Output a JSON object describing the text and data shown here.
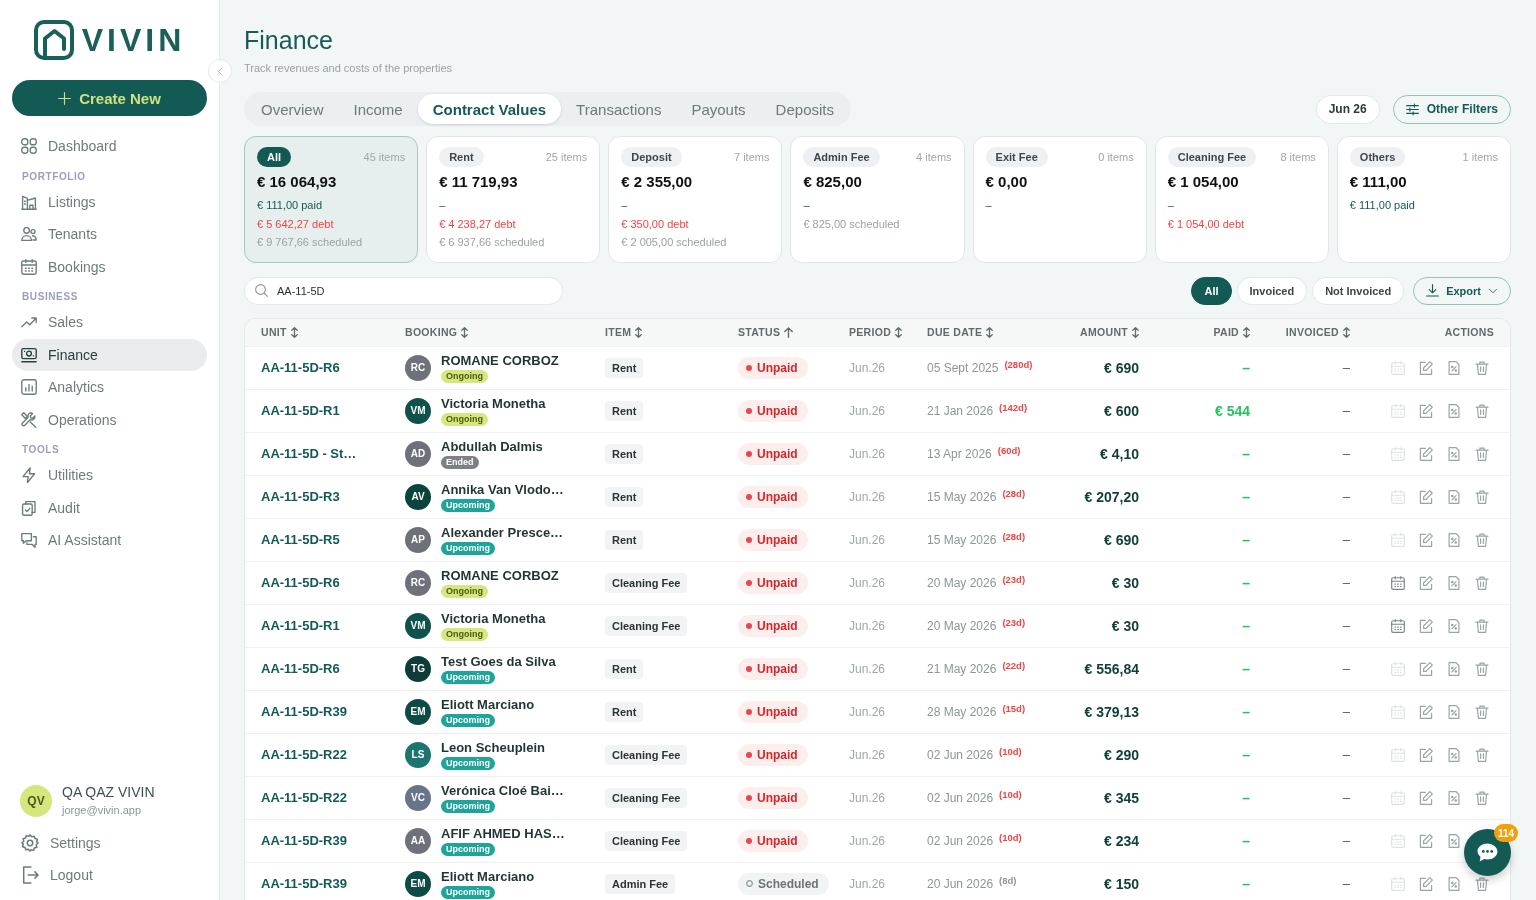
{
  "sidebar": {
    "logo": "VIVIN",
    "create_button": "Create New",
    "nav": [
      {
        "kind": "item",
        "label": "Dashboard",
        "selected": false
      },
      {
        "kind": "section",
        "label": "PORTFOLIO"
      },
      {
        "kind": "item",
        "label": "Listings",
        "selected": false
      },
      {
        "kind": "item",
        "label": "Tenants",
        "selected": false
      },
      {
        "kind": "item",
        "label": "Bookings",
        "selected": false
      },
      {
        "kind": "section",
        "label": "BUSINESS"
      },
      {
        "kind": "item",
        "label": "Sales",
        "selected": false
      },
      {
        "kind": "item",
        "label": "Finance",
        "selected": true
      },
      {
        "kind": "item",
        "label": "Analytics",
        "selected": false
      },
      {
        "kind": "item",
        "label": "Operations",
        "selected": false
      },
      {
        "kind": "section",
        "label": "TOOLS"
      },
      {
        "kind": "item",
        "label": "Utilities",
        "selected": false
      },
      {
        "kind": "item",
        "label": "Audit",
        "selected": false
      },
      {
        "kind": "item",
        "label": "AI Assistant",
        "selected": false
      }
    ],
    "user": {
      "initials": "QV",
      "name": "QA QAZ VIVIN",
      "email": "jorge@vivin.app"
    },
    "footer_items": [
      "Settings",
      "Logout"
    ]
  },
  "header": {
    "title": "Finance",
    "subtitle": "Track revenues and costs of the properties"
  },
  "tabs": [
    {
      "label": "Overview",
      "selected": false
    },
    {
      "label": "Income",
      "selected": false
    },
    {
      "label": "Contract Values",
      "selected": true
    },
    {
      "label": "Transactions",
      "selected": false
    },
    {
      "label": "Payouts",
      "selected": false
    },
    {
      "label": "Deposits",
      "selected": false
    }
  ],
  "date_button": "Jun 26",
  "filters_button": "Other Filters",
  "cards": [
    {
      "label": "All",
      "count": "45 items",
      "amount": "€ 16 064,93",
      "selected": true,
      "lines": [
        {
          "kind": "paid",
          "text": "€ 111,00 paid"
        },
        {
          "kind": "debt",
          "text": "€ 5 642,27 debt"
        },
        {
          "kind": "scheduled",
          "text": "€ 9 767,66 scheduled"
        }
      ]
    },
    {
      "label": "Rent",
      "count": "25 items",
      "amount": "€ 11 719,93",
      "selected": false,
      "lines": [
        {
          "kind": "none",
          "text": "–"
        },
        {
          "kind": "debt",
          "text": "€ 4 238,27 debt"
        },
        {
          "kind": "scheduled",
          "text": "€ 6 937,66 scheduled"
        }
      ]
    },
    {
      "label": "Deposit",
      "count": "7 items",
      "amount": "€ 2 355,00",
      "selected": false,
      "lines": [
        {
          "kind": "none",
          "text": "–"
        },
        {
          "kind": "debt",
          "text": "€ 350,00 debt"
        },
        {
          "kind": "scheduled",
          "text": "€ 2 005,00 scheduled"
        }
      ]
    },
    {
      "label": "Admin Fee",
      "count": "4 items",
      "amount": "€ 825,00",
      "selected": false,
      "lines": [
        {
          "kind": "none",
          "text": "–"
        },
        {
          "kind": "scheduled",
          "text": "€ 825,00 scheduled"
        }
      ]
    },
    {
      "label": "Exit Fee",
      "count": "0 items",
      "amount": "€ 0,00",
      "selected": false,
      "lines": [
        {
          "kind": "none",
          "text": "–"
        }
      ]
    },
    {
      "label": "Cleaning Fee",
      "count": "8 items",
      "amount": "€ 1 054,00",
      "selected": false,
      "lines": [
        {
          "kind": "none",
          "text": "–"
        },
        {
          "kind": "debt",
          "text": "€ 1 054,00 debt"
        }
      ]
    },
    {
      "label": "Others",
      "count": "1 items",
      "amount": "€ 111,00",
      "selected": false,
      "lines": [
        {
          "kind": "paid",
          "text": "€ 111,00 paid"
        }
      ]
    }
  ],
  "search": {
    "value": "AA-11-5D"
  },
  "invoice_filters": [
    {
      "label": "All",
      "selected": true
    },
    {
      "label": "Invoiced",
      "selected": false
    },
    {
      "label": "Not Invoiced",
      "selected": false
    }
  ],
  "export_button": "Export",
  "table": {
    "columns": [
      {
        "label": "UNIT",
        "sortable": true,
        "sorted": false
      },
      {
        "label": "BOOKING",
        "sortable": true,
        "sorted": false
      },
      {
        "label": "ITEM",
        "sortable": true,
        "sorted": false
      },
      {
        "label": "STATUS",
        "sortable": true,
        "sorted": true
      },
      {
        "label": "PERIOD",
        "sortable": true,
        "sorted": false
      },
      {
        "label": "DUE DATE",
        "sortable": true,
        "sorted": false
      },
      {
        "label": "AMOUNT",
        "sortable": true,
        "sorted": false
      },
      {
        "label": "PAID",
        "sortable": true,
        "sorted": false
      },
      {
        "label": "INVOICED",
        "sortable": true,
        "sorted": false
      },
      {
        "label": "ACTIONS",
        "sortable": false
      }
    ],
    "rows": [
      {
        "unit": "AA-11-5D-R6",
        "avatar": {
          "initials": "RC",
          "color": "#6e7179"
        },
        "name": "ROMANE CORBOZ",
        "booking_status": {
          "kind": "ongoing",
          "label": "Ongoing"
        },
        "item": "Rent",
        "status": {
          "kind": "unpaid",
          "label": "Unpaid"
        },
        "period": "Jun.26",
        "due_date": "05 Sept 2025",
        "due_tag": {
          "kind": "overdue",
          "label": "(280d)"
        },
        "amount": "€ 690",
        "paid": "–",
        "invoiced": "–",
        "actions": [
          {
            "kind": "calendar",
            "enabled": false
          },
          {
            "kind": "edit"
          },
          {
            "kind": "invoice"
          },
          {
            "kind": "delete"
          }
        ]
      },
      {
        "unit": "AA-11-5D-R1",
        "avatar": {
          "initials": "VM",
          "color": "#0f524c"
        },
        "name": "Victoria Monetha",
        "booking_status": {
          "kind": "ongoing",
          "label": "Ongoing"
        },
        "item": "Rent",
        "status": {
          "kind": "unpaid",
          "label": "Unpaid"
        },
        "period": "Jun.26",
        "due_date": "21 Jan 2026",
        "due_tag": {
          "kind": "overdue",
          "label": "(142d)"
        },
        "amount": "€ 600",
        "paid": "€ 544",
        "invoiced": "–",
        "actions": [
          {
            "kind": "calendar",
            "enabled": false
          },
          {
            "kind": "edit"
          },
          {
            "kind": "invoice"
          },
          {
            "kind": "delete"
          }
        ]
      },
      {
        "unit": "AA-11-5D - St…",
        "avatar": {
          "initials": "AD",
          "color": "#6e7179"
        },
        "name": "Abdullah Dalmis",
        "booking_status": {
          "kind": "ended",
          "label": "Ended"
        },
        "item": "Rent",
        "status": {
          "kind": "unpaid",
          "label": "Unpaid"
        },
        "period": "Jun.26",
        "due_date": "13 Apr 2026",
        "due_tag": {
          "kind": "overdue",
          "label": "(60d)"
        },
        "amount": "€ 4,10",
        "paid": "–",
        "invoiced": "–",
        "actions": [
          {
            "kind": "calendar",
            "enabled": false
          },
          {
            "kind": "edit"
          },
          {
            "kind": "invoice"
          },
          {
            "kind": "delete"
          }
        ]
      },
      {
        "unit": "AA-11-5D-R3",
        "avatar": {
          "initials": "AV",
          "color": "#0b433d"
        },
        "name": "Annika Van Vlodo…",
        "booking_status": {
          "kind": "upcoming",
          "label": "Upcoming"
        },
        "item": "Rent",
        "status": {
          "kind": "unpaid",
          "label": "Unpaid"
        },
        "period": "Jun.26",
        "due_date": "15 May 2026",
        "due_tag": {
          "kind": "overdue",
          "label": "(28d)"
        },
        "amount": "€ 207,20",
        "paid": "–",
        "invoiced": "–",
        "actions": [
          {
            "kind": "calendar",
            "enabled": false
          },
          {
            "kind": "edit"
          },
          {
            "kind": "invoice"
          },
          {
            "kind": "delete"
          }
        ]
      },
      {
        "unit": "AA-11-5D-R5",
        "avatar": {
          "initials": "AP",
          "color": "#6e7179"
        },
        "name": "Alexander Presce…",
        "booking_status": {
          "kind": "upcoming",
          "label": "Upcoming"
        },
        "item": "Rent",
        "status": {
          "kind": "unpaid",
          "label": "Unpaid"
        },
        "period": "Jun.26",
        "due_date": "15 May 2026",
        "due_tag": {
          "kind": "overdue",
          "label": "(28d)"
        },
        "amount": "€ 690",
        "paid": "–",
        "invoiced": "–",
        "actions": [
          {
            "kind": "calendar",
            "enabled": false
          },
          {
            "kind": "edit"
          },
          {
            "kind": "invoice"
          },
          {
            "kind": "delete"
          }
        ]
      },
      {
        "unit": "AA-11-5D-R6",
        "avatar": {
          "initials": "RC",
          "color": "#6e7179"
        },
        "name": "ROMANE CORBOZ",
        "booking_status": {
          "kind": "ongoing",
          "label": "Ongoing"
        },
        "item": "Cleaning Fee",
        "status": {
          "kind": "unpaid",
          "label": "Unpaid"
        },
        "period": "Jun.26",
        "due_date": "20 May 2026",
        "due_tag": {
          "kind": "overdue",
          "label": "(23d)"
        },
        "amount": "€ 30",
        "paid": "–",
        "invoiced": "–",
        "actions": [
          {
            "kind": "calendar",
            "enabled": true
          },
          {
            "kind": "edit"
          },
          {
            "kind": "invoice"
          },
          {
            "kind": "delete"
          }
        ]
      },
      {
        "unit": "AA-11-5D-R1",
        "avatar": {
          "initials": "VM",
          "color": "#0f524c"
        },
        "name": "Victoria Monetha",
        "booking_status": {
          "kind": "ongoing",
          "label": "Ongoing"
        },
        "item": "Cleaning Fee",
        "status": {
          "kind": "unpaid",
          "label": "Unpaid"
        },
        "period": "Jun.26",
        "due_date": "20 May 2026",
        "due_tag": {
          "kind": "overdue",
          "label": "(23d)"
        },
        "amount": "€ 30",
        "paid": "–",
        "invoiced": "–",
        "actions": [
          {
            "kind": "calendar",
            "enabled": true
          },
          {
            "kind": "edit"
          },
          {
            "kind": "invoice"
          },
          {
            "kind": "delete"
          }
        ]
      },
      {
        "unit": "AA-11-5D-R6",
        "avatar": {
          "initials": "TG",
          "color": "#0e3d39"
        },
        "name": "Test Goes da Silva",
        "booking_status": {
          "kind": "upcoming",
          "label": "Upcoming"
        },
        "item": "Rent",
        "status": {
          "kind": "unpaid",
          "label": "Unpaid"
        },
        "period": "Jun.26",
        "due_date": "21 May 2026",
        "due_tag": {
          "kind": "overdue",
          "label": "(22d)"
        },
        "amount": "€ 556,84",
        "paid": "–",
        "invoiced": "–",
        "actions": [
          {
            "kind": "calendar",
            "enabled": false
          },
          {
            "kind": "edit"
          },
          {
            "kind": "invoice"
          },
          {
            "kind": "delete"
          }
        ]
      },
      {
        "unit": "AA-11-5D-R39",
        "avatar": {
          "initials": "EM",
          "color": "#0f4b45"
        },
        "name": "Eliott Marciano",
        "booking_status": {
          "kind": "upcoming",
          "label": "Upcoming"
        },
        "item": "Rent",
        "status": {
          "kind": "unpaid",
          "label": "Unpaid"
        },
        "period": "Jun.26",
        "due_date": "28 May 2026",
        "due_tag": {
          "kind": "overdue",
          "label": "(15d)"
        },
        "amount": "€ 379,13",
        "paid": "–",
        "invoiced": "–",
        "actions": [
          {
            "kind": "calendar",
            "enabled": false
          },
          {
            "kind": "edit"
          },
          {
            "kind": "invoice"
          },
          {
            "kind": "delete"
          }
        ]
      },
      {
        "unit": "AA-11-5D-R22",
        "avatar": {
          "initials": "LS",
          "color": "#1e756d"
        },
        "name": "Leon Scheuplein",
        "booking_status": {
          "kind": "upcoming",
          "label": "Upcoming"
        },
        "item": "Cleaning Fee",
        "status": {
          "kind": "unpaid",
          "label": "Unpaid"
        },
        "period": "Jun.26",
        "due_date": "02 Jun 2026",
        "due_tag": {
          "kind": "overdue",
          "label": "(10d)"
        },
        "amount": "€ 290",
        "paid": "–",
        "invoiced": "–",
        "actions": [
          {
            "kind": "calendar",
            "enabled": false
          },
          {
            "kind": "edit"
          },
          {
            "kind": "invoice"
          },
          {
            "kind": "delete"
          }
        ]
      },
      {
        "unit": "AA-11-5D-R22",
        "avatar": {
          "initials": "VC",
          "color": "#677489"
        },
        "name": "Verónica Cloé Bai…",
        "booking_status": {
          "kind": "upcoming",
          "label": "Upcoming"
        },
        "item": "Cleaning Fee",
        "status": {
          "kind": "unpaid",
          "label": "Unpaid"
        },
        "period": "Jun.26",
        "due_date": "02 Jun 2026",
        "due_tag": {
          "kind": "overdue",
          "label": "(10d)"
        },
        "amount": "€ 345",
        "paid": "–",
        "invoiced": "–",
        "actions": [
          {
            "kind": "calendar",
            "enabled": false
          },
          {
            "kind": "edit"
          },
          {
            "kind": "invoice"
          },
          {
            "kind": "delete"
          }
        ]
      },
      {
        "unit": "AA-11-5D-R39",
        "avatar": {
          "initials": "AA",
          "color": "#6e7179"
        },
        "name": "AFIF AHMED HAS…",
        "booking_status": {
          "kind": "upcoming",
          "label": "Upcoming"
        },
        "item": "Cleaning Fee",
        "status": {
          "kind": "unpaid",
          "label": "Unpaid"
        },
        "period": "Jun.26",
        "due_date": "02 Jun 2026",
        "due_tag": {
          "kind": "overdue",
          "label": "(10d)"
        },
        "amount": "€ 234",
        "paid": "–",
        "invoiced": "–",
        "actions": [
          {
            "kind": "calendar",
            "enabled": false
          },
          {
            "kind": "edit"
          },
          {
            "kind": "invoice"
          }
        ]
      },
      {
        "unit": "AA-11-5D-R39",
        "avatar": {
          "initials": "EM",
          "color": "#0f4b45"
        },
        "name": "Eliott Marciano",
        "booking_status": {
          "kind": "upcoming",
          "label": "Upcoming"
        },
        "item": "Admin Fee",
        "status": {
          "kind": "scheduled",
          "label": "Scheduled"
        },
        "period": "Jun.26",
        "due_date": "20 Jun 2026",
        "due_tag": {
          "kind": "upcoming",
          "label": "(8d)"
        },
        "amount": "€ 150",
        "paid": "–",
        "invoiced": "–",
        "actions": [
          {
            "kind": "calendar",
            "enabled": false
          },
          {
            "kind": "edit"
          },
          {
            "kind": "invoice"
          },
          {
            "kind": "delete"
          }
        ]
      }
    ]
  },
  "chat": {
    "badge": "114"
  }
}
